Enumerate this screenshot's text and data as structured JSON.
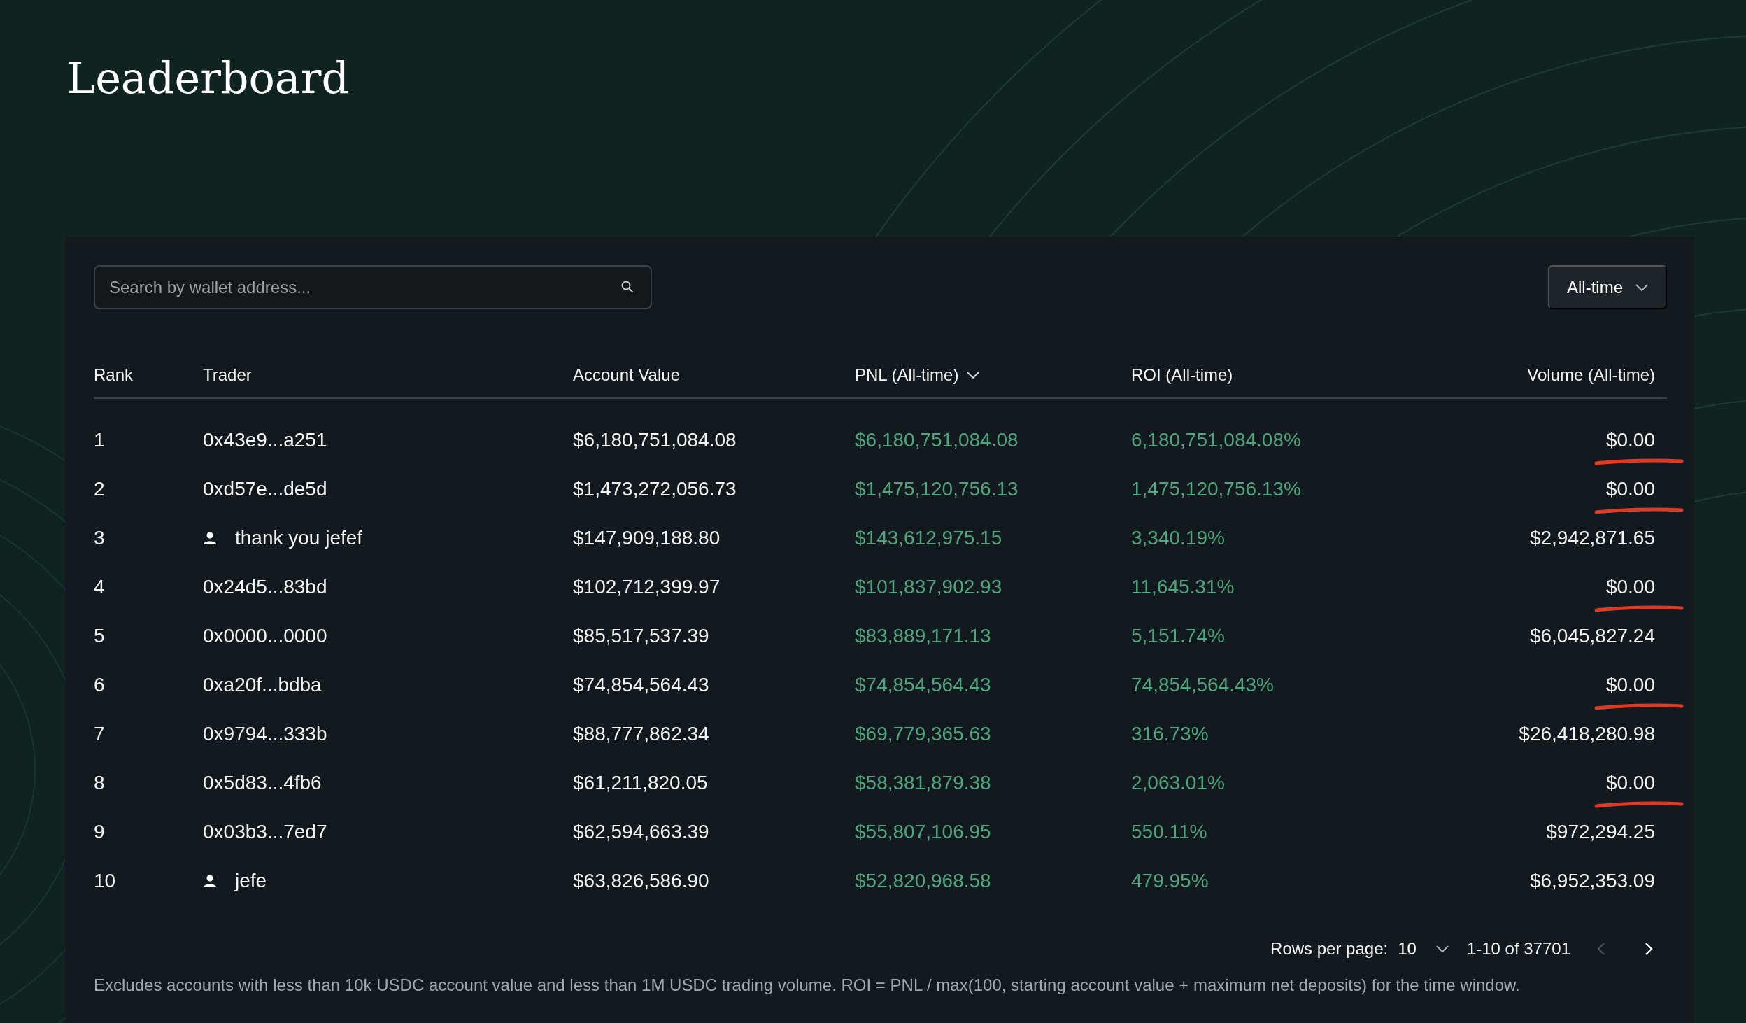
{
  "title": "Leaderboard",
  "search": {
    "placeholder": "Search by wallet address..."
  },
  "period_dropdown": {
    "value": "All-time"
  },
  "table": {
    "columns": [
      {
        "label": "Rank",
        "sorted": false
      },
      {
        "label": "Trader",
        "sorted": false
      },
      {
        "label": "Account Value",
        "sorted": false
      },
      {
        "label": "PNL (All-time)",
        "sorted": true
      },
      {
        "label": "ROI (All-time)",
        "sorted": false
      },
      {
        "label": "Volume (All-time)",
        "sorted": false
      }
    ],
    "rows": [
      {
        "rank": "1",
        "trader": {
          "kind": "address",
          "name": "0x43e9...a251"
        },
        "account_value": "$6,180,751,084.08",
        "pnl": "$6,180,751,084.08",
        "roi": "6,180,751,084.08%",
        "volume": "$0.00",
        "underlined": true
      },
      {
        "rank": "2",
        "trader": {
          "kind": "address",
          "name": "0xd57e...de5d"
        },
        "account_value": "$1,473,272,056.73",
        "pnl": "$1,475,120,756.13",
        "roi": "1,475,120,756.13%",
        "volume": "$0.00",
        "underlined": true
      },
      {
        "rank": "3",
        "trader": {
          "kind": "user",
          "name": "thank you jefef"
        },
        "account_value": "$147,909,188.80",
        "pnl": "$143,612,975.15",
        "roi": "3,340.19%",
        "volume": "$2,942,871.65",
        "underlined": false
      },
      {
        "rank": "4",
        "trader": {
          "kind": "address",
          "name": "0x24d5...83bd"
        },
        "account_value": "$102,712,399.97",
        "pnl": "$101,837,902.93",
        "roi": "11,645.31%",
        "volume": "$0.00",
        "underlined": true
      },
      {
        "rank": "5",
        "trader": {
          "kind": "address",
          "name": "0x0000...0000"
        },
        "account_value": "$85,517,537.39",
        "pnl": "$83,889,171.13",
        "roi": "5,151.74%",
        "volume": "$6,045,827.24",
        "underlined": false
      },
      {
        "rank": "6",
        "trader": {
          "kind": "address",
          "name": "0xa20f...bdba"
        },
        "account_value": "$74,854,564.43",
        "pnl": "$74,854,564.43",
        "roi": "74,854,564.43%",
        "volume": "$0.00",
        "underlined": true
      },
      {
        "rank": "7",
        "trader": {
          "kind": "address",
          "name": "0x9794...333b"
        },
        "account_value": "$88,777,862.34",
        "pnl": "$69,779,365.63",
        "roi": "316.73%",
        "volume": "$26,418,280.98",
        "underlined": false
      },
      {
        "rank": "8",
        "trader": {
          "kind": "address",
          "name": "0x5d83...4fb6"
        },
        "account_value": "$61,211,820.05",
        "pnl": "$58,381,879.38",
        "roi": "2,063.01%",
        "volume": "$0.00",
        "underlined": true
      },
      {
        "rank": "9",
        "trader": {
          "kind": "address",
          "name": "0x03b3...7ed7"
        },
        "account_value": "$62,594,663.39",
        "pnl": "$55,807,106.95",
        "roi": "550.11%",
        "volume": "$972,294.25",
        "underlined": false
      },
      {
        "rank": "10",
        "trader": {
          "kind": "user",
          "name": "jefe"
        },
        "account_value": "$63,826,586.90",
        "pnl": "$52,820,968.58",
        "roi": "479.95%",
        "volume": "$6,952,353.09",
        "underlined": false
      }
    ]
  },
  "pagination": {
    "rows_per_page_label": "Rows per page:",
    "rows_per_page": "10",
    "range": "1-10 of 37701",
    "previous_disabled": true,
    "next_disabled": false
  },
  "footnote": "Excludes accounts with less than 10k USDC account value and less than 1M USDC trading volume. ROI = PNL / max(100, starting account value + maximum net deposits) for the time window."
}
